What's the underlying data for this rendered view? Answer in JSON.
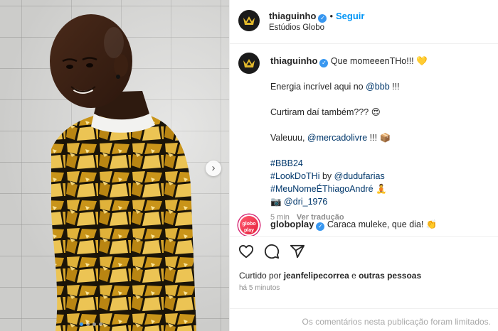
{
  "post": {
    "author": "thiaguinho",
    "follow_label": "Seguir",
    "separator": "•",
    "location": "Estúdios Globo",
    "verified_mark": "✓"
  },
  "caption": {
    "author": "thiaguinho",
    "line1": "Que momeeenTHo!!! 💛",
    "line2_pre": "Energia incrível aqui no ",
    "line2_mention": "@bbb",
    "line2_post": " !!!",
    "line3": "Curtiram daí também??? 😍",
    "line4_pre": "Valeuuu, ",
    "line4_mention": "@mercadolivre",
    "line4_post": " !!! 📦",
    "hashtag1": "#BBB24",
    "line6_tag": "#LookDoTHi",
    "line6_by": " by ",
    "line6_mention": "@dudufarias",
    "line7_tag": "#MeuNomeÉThiagoAndré",
    "line7_emoji": " 🧘",
    "line8_emoji": "📷 ",
    "line8_mention": "@dri_1976",
    "time": "5 min",
    "translate": "Ver tradução"
  },
  "comment": {
    "author": "globoplay",
    "avatar_text": "globo play",
    "text": "Caraca muleke, que dia! 👏"
  },
  "actions": {
    "icons": [
      "heart-icon",
      "comment-icon",
      "share-icon"
    ],
    "liked_by_prefix": "Curtido por ",
    "liked_by_user": "jeanfelipecorrea",
    "liked_by_mid": " e ",
    "liked_by_rest": "outras pessoas",
    "timestamp": "há 5 minutos"
  },
  "footer": {
    "limited_text": "Os comentários nesta publicação foram limitados."
  },
  "carousel": {
    "next_glyph": "›",
    "dots_count": 4,
    "active_dot": 1
  },
  "colors": {
    "accent": "#0095f6",
    "verified": "#3897f0",
    "mention": "#00376b",
    "muted": "#8e8e8e",
    "jacket_gold": "#d9a520"
  }
}
